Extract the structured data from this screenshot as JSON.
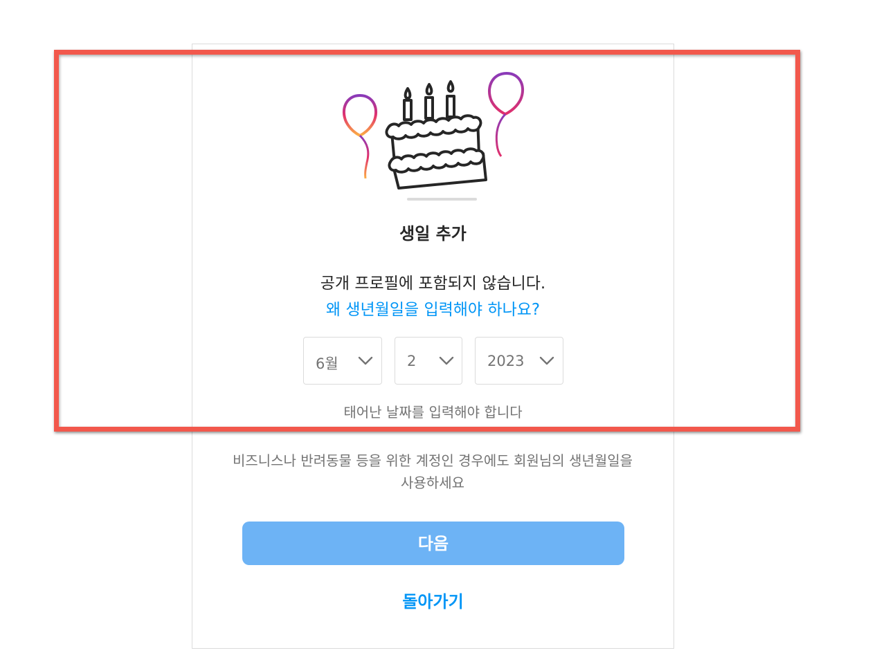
{
  "dialog": {
    "title": "생일 추가",
    "description": "공개 프로필에 포함되지 않습니다.",
    "why_link": "왜 생년월일을 입력해야 하나요?",
    "birthday": {
      "month": "6월",
      "day": "2",
      "year": "2023"
    },
    "hint": "태어난 날짜를 입력해야 합니다",
    "note": "비즈니스나 반려동물 등을 위한 계정인 경우에도 회원님의 생년월일을 사용하세요",
    "next_label": "다음",
    "back_label": "돌아가기"
  },
  "colors": {
    "link": "#0095f6",
    "button_disabled": "#6db3f5",
    "highlight": "#f2584c"
  },
  "icons": [
    "birthday-cake-icon",
    "balloon-icon",
    "chevron-down-icon"
  ]
}
